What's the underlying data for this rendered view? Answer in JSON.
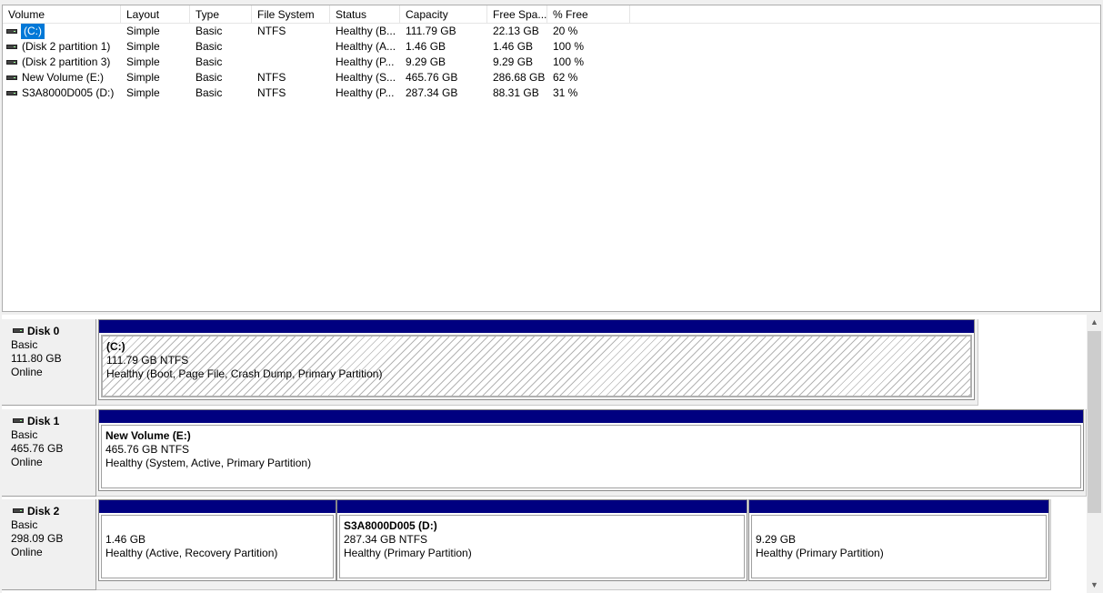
{
  "columns": [
    "Volume",
    "Layout",
    "Type",
    "File System",
    "Status",
    "Capacity",
    "Free Spa...",
    "% Free"
  ],
  "volumes": [
    {
      "volume": "(C:)",
      "layout": "Simple",
      "type": "Basic",
      "fs": "NTFS",
      "status": "Healthy (B...",
      "capacity": "111.79 GB",
      "free": "22.13 GB",
      "pct": "20 %",
      "selected": true
    },
    {
      "volume": "(Disk 2 partition 1)",
      "layout": "Simple",
      "type": "Basic",
      "fs": "",
      "status": "Healthy (A...",
      "capacity": "1.46 GB",
      "free": "1.46 GB",
      "pct": "100 %"
    },
    {
      "volume": "(Disk 2 partition 3)",
      "layout": "Simple",
      "type": "Basic",
      "fs": "",
      "status": "Healthy (P...",
      "capacity": "9.29 GB",
      "free": "9.29 GB",
      "pct": "100 %"
    },
    {
      "volume": "New Volume (E:)",
      "layout": "Simple",
      "type": "Basic",
      "fs": "NTFS",
      "status": "Healthy (S...",
      "capacity": "465.76 GB",
      "free": "286.68 GB",
      "pct": "62 %"
    },
    {
      "volume": "S3A8000D005 (D:)",
      "layout": "Simple",
      "type": "Basic",
      "fs": "NTFS",
      "status": "Healthy (P...",
      "capacity": "287.34 GB",
      "free": "88.31 GB",
      "pct": "31 %"
    }
  ],
  "disks": [
    {
      "name": "Disk 0",
      "type": "Basic",
      "size": "111.80 GB",
      "state": "Online",
      "partitions": [
        {
          "name": "(C:)",
          "size": "111.79 GB NTFS",
          "status": "Healthy (Boot, Page File, Crash Dump, Primary Partition)",
          "hatched": true
        }
      ]
    },
    {
      "name": "Disk 1",
      "type": "Basic",
      "size": "465.76 GB",
      "state": "Online",
      "partitions": [
        {
          "name": "New Volume  (E:)",
          "size": "465.76 GB NTFS",
          "status": "Healthy (System, Active, Primary Partition)"
        }
      ]
    },
    {
      "name": "Disk 2",
      "type": "Basic",
      "size": "298.09 GB",
      "state": "Online",
      "partitions": [
        {
          "name": "",
          "size": "1.46 GB",
          "status": "Healthy (Active, Recovery Partition)"
        },
        {
          "name": "S3A8000D005  (D:)",
          "size": "287.34 GB NTFS",
          "status": "Healthy (Primary Partition)"
        },
        {
          "name": "",
          "size": "9.29 GB",
          "status": "Healthy (Primary Partition)"
        }
      ]
    }
  ],
  "icons": {
    "drive": "disk-drive-icon",
    "scroll_up": "scroll-up-arrow-icon",
    "scroll_down": "scroll-down-arrow-icon"
  },
  "colors": {
    "partition_bar": "#000080",
    "selection": "#0078d7"
  }
}
